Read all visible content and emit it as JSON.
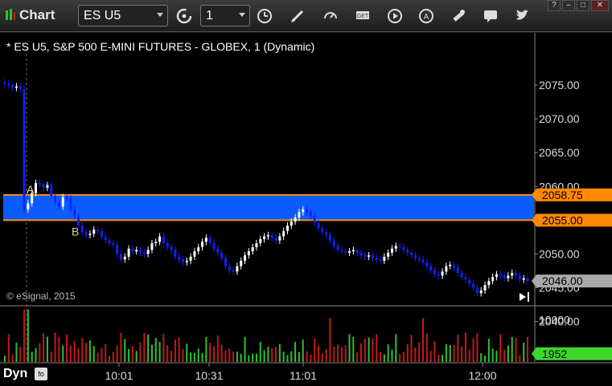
{
  "toolbar": {
    "app_title": "Chart",
    "symbol_value": "ES U5",
    "interval_value": "1",
    "buttons": [
      "refresh-cycle-icon",
      "clock-icon",
      "pencil-icon",
      "speedometer-icon",
      "get-icon",
      "play-icon",
      "font-a-icon",
      "tools-icon",
      "chat-icon",
      "twitter-icon"
    ],
    "window_controls": [
      "?",
      "–",
      "□",
      "✕"
    ]
  },
  "chart": {
    "symbol_title": "* ES U5, S&P 500 E-MINI FUTURES - GLOBEX, 1 (Dynamic)",
    "copyright": "© eSignal, 2015",
    "dyn_label": "Dyn",
    "dyn_icon_text": "fo",
    "marker_a": "A",
    "marker_b": "B",
    "upper_level_label": "2058.75",
    "lower_level_label": "2055.00",
    "last_price_label": "2046.00",
    "volume_last_label": "1952",
    "colors": {
      "zone": "#0a5cff",
      "level": "#ff8a00",
      "up": "#ffffff",
      "down": "#1020ff",
      "vol_up": "#2ec22e",
      "vol_down": "#c21a1a",
      "last": "#aaaaaa",
      "vol_last": "#3cd62a"
    }
  },
  "chart_data": {
    "type": "candlestick",
    "y_ticks": [
      "2075.00",
      "2070.00",
      "2065.00",
      "2060.00",
      "2055.00",
      "2050.00",
      "2045.00",
      "2040.00"
    ],
    "ylim": [
      2040,
      2076.5
    ],
    "x_ticks": [
      "10:01",
      "10:31",
      "11:01",
      "12:00"
    ],
    "volume_ticks": [
      "10000"
    ],
    "zone": [
      2055.0,
      2058.75
    ],
    "last_price": 2046.0,
    "last_volume": 1952,
    "close_path": [
      2075.2,
      2075.0,
      2074.6,
      2074.8,
      2074.4,
      2056.6,
      2057.5,
      2059.0,
      2060.5,
      2060.3,
      2059.8,
      2060.2,
      2058.6,
      2057.6,
      2057.0,
      2058.4,
      2058.2,
      2056.6,
      2055.6,
      2054.2,
      2053.2,
      2052.8,
      2053.0,
      2053.6,
      2053.4,
      2052.6,
      2052.0,
      2051.6,
      2051.4,
      2050.0,
      2049.2,
      2049.6,
      2050.8,
      2050.4,
      2050.6,
      2050.2,
      2050.0,
      2050.6,
      2051.6,
      2051.8,
      2052.6,
      2051.6,
      2051.0,
      2050.6,
      2049.6,
      2049.2,
      2048.8,
      2049.0,
      2049.6,
      2050.4,
      2051.0,
      2051.8,
      2052.4,
      2051.6,
      2050.8,
      2050.2,
      2049.4,
      2048.2,
      2047.6,
      2047.4,
      2048.2,
      2049.0,
      2049.8,
      2050.4,
      2051.0,
      2051.6,
      2052.2,
      2052.6,
      2052.8,
      2052.4,
      2052.0,
      2052.6,
      2053.4,
      2054.2,
      2054.8,
      2055.4,
      2056.2,
      2056.6,
      2056.2,
      2055.6,
      2054.6,
      2053.8,
      2053.2,
      2052.8,
      2052.0,
      2051.2,
      2050.6,
      2050.4,
      2050.2,
      2050.4,
      2050.6,
      2050.2,
      2049.8,
      2049.6,
      2049.8,
      2049.4,
      2049.2,
      2049.0,
      2049.6,
      2050.2,
      2050.8,
      2051.2,
      2051.0,
      2050.6,
      2050.2,
      2049.8,
      2049.4,
      2049.2,
      2048.8,
      2048.2,
      2047.6,
      2047.0,
      2046.8,
      2047.4,
      2048.2,
      2048.4,
      2048.0,
      2047.2,
      2046.6,
      2046.2,
      2045.6,
      2045.0,
      2044.2,
      2044.6,
      2045.4,
      2046.0,
      2046.6,
      2047.0,
      2046.8,
      2046.4,
      2046.8,
      2047.2,
      2046.8,
      2046.2,
      2046.4,
      2046.0
    ]
  }
}
